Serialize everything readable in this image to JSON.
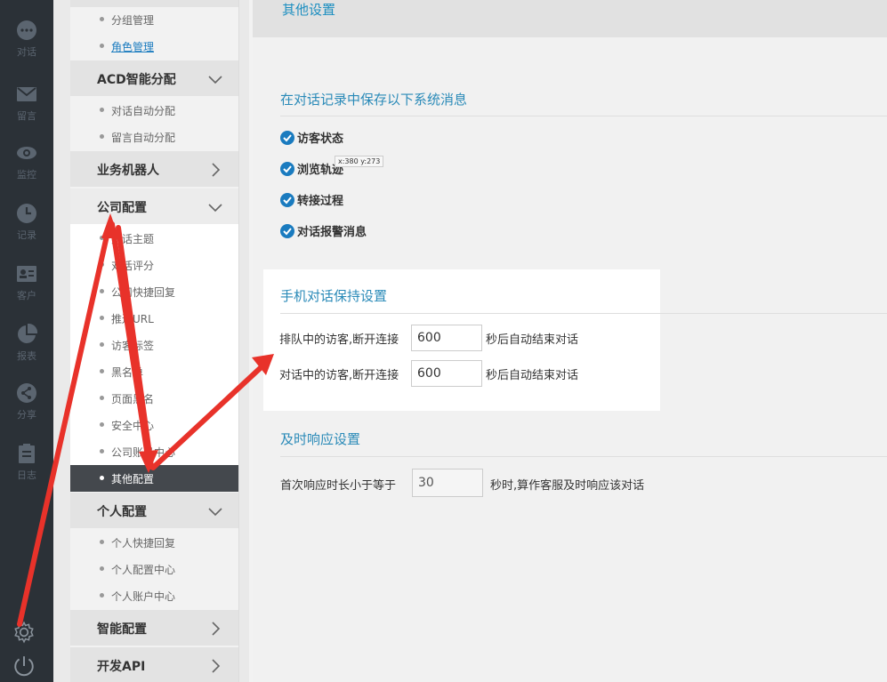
{
  "rail": {
    "items": [
      {
        "label": "对话",
        "icon": "chat-icon"
      },
      {
        "label": "留言",
        "icon": "mail-icon"
      },
      {
        "label": "监控",
        "icon": "eye-icon"
      },
      {
        "label": "记录",
        "icon": "clock-icon"
      },
      {
        "label": "客户",
        "icon": "contact-card-icon"
      },
      {
        "label": "报表",
        "icon": "pie-chart-icon"
      },
      {
        "label": "分享",
        "icon": "share-icon"
      },
      {
        "label": "日志",
        "icon": "clipboard-icon"
      }
    ]
  },
  "menu": {
    "sub_group_mgmt": "分组管理",
    "sub_role_mgmt": "角色管理",
    "acd": "ACD智能分配",
    "acd_items": [
      "对话自动分配",
      "留言自动分配"
    ],
    "bot": "业务机器人",
    "company": "公司配置",
    "company_items": [
      "对话主题",
      "对话评分",
      "公司快捷回复",
      "推送URL",
      "访客标签",
      "黑名单",
      "页面黑名",
      "安全中心",
      "公司账号中心",
      "其他配置"
    ],
    "personal": "个人配置",
    "personal_items": [
      "个人快捷回复",
      "个人配置中心",
      "个人账户中心"
    ],
    "smart": "智能配置",
    "api": "开发API"
  },
  "main": {
    "top_title": "其他设置",
    "save_msgs_title": "在对话记录中保存以下系统消息",
    "checks": [
      "访客状态",
      "浏览轨迹",
      "转接过程",
      "对话报警消息"
    ],
    "tooltip": "x:380 y:273",
    "mobile_title": "手机对话保持设置",
    "queue_label": "排队中的访客,断开连接",
    "queue_value": "600",
    "queue_suffix": "秒后自动结束对话",
    "chat_label": "对话中的访客,断开连接",
    "chat_value": "600",
    "chat_suffix": "秒后自动结束对话",
    "response_title": "及时响应设置",
    "resp_label": "首次响应时长小于等于",
    "resp_value": "30",
    "resp_suffix": "秒时,算作客服及时响应该对话"
  },
  "colors": {
    "accent": "#2a8ab8",
    "rail": "#2b3137",
    "annotation": "#e8322a",
    "check": "#1a7bbf"
  }
}
